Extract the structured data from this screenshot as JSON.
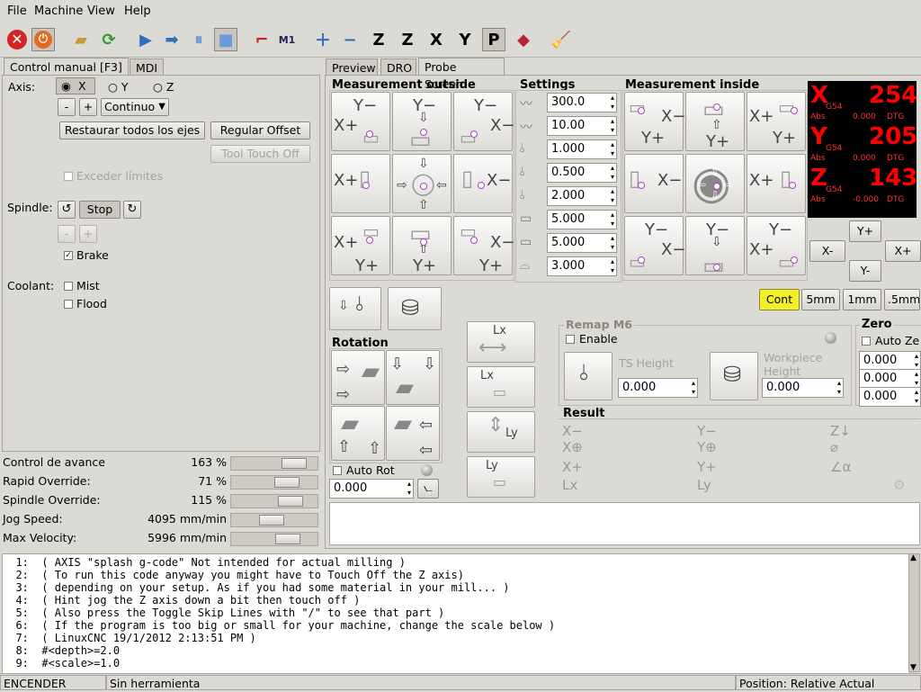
{
  "menu": {
    "file": "File",
    "machine": "Machine",
    "view": "View",
    "help": "Help"
  },
  "left_tabs": [
    "Control manual [F3]",
    "MDI"
  ],
  "manual": {
    "axis_label": "Axis:",
    "axes": [
      "X",
      "Y",
      "Z"
    ],
    "minus": "-",
    "plus": "+",
    "jog_mode": "Continuo",
    "restore_all": "Restaurar todos los ejes",
    "touch_off": "Regular Offset",
    "tool_touch_off": "Tool Touch Off",
    "override_limits": "Exceder límites",
    "spindle_label": "Spindle:",
    "stop": "Stop",
    "brake": "Brake",
    "coolant_label": "Coolant:",
    "mist": "Mist",
    "flood": "Flood"
  },
  "overrides": [
    {
      "label": "Control de avance",
      "value": "163 %",
      "level": 0.82
    },
    {
      "label": "Rapid Override:",
      "value": "71 %",
      "level": 0.71
    },
    {
      "label": "Spindle Override:",
      "value": "115 %",
      "level": 0.76
    },
    {
      "label": "Jog Speed:",
      "value": "4095 mm/min",
      "level": 0.45
    },
    {
      "label": "Max Velocity:",
      "value": "5996 mm/min",
      "level": 0.72
    }
  ],
  "right_tabs": [
    "Preview",
    "DRO",
    "Probe Screen"
  ],
  "probe": {
    "outside_title": "Measurement outside",
    "settings_title": "Settings",
    "inside_title": "Measurement inside",
    "settings": [
      "300.0",
      "10.00",
      "1.000",
      "0.500",
      "2.000",
      "5.000",
      "5.000",
      "3.000"
    ],
    "rotation_title": "Rotation",
    "auto_rot": "Auto Rot",
    "rot_value": "0.000",
    "remap_title": "Remap M6",
    "enable": "Enable",
    "ts_height": "TS Height",
    "ts_value": "0.000",
    "workpiece_height": "Workpiece\nHeight",
    "wp_value": "0.000",
    "result_title": "Result",
    "zero_title": "Zero",
    "auto_zero": "Auto Ze",
    "zero_values": [
      "0.000",
      "0.000",
      "0.000"
    ],
    "jog_steps": [
      "Cont",
      "5mm",
      "1mm",
      ".5mm"
    ],
    "jog_labels": {
      "yplus": "Y+",
      "xminus": "X-",
      "xplus": "X+",
      "yminus": "Y-"
    }
  },
  "dro": [
    {
      "axis": "X",
      "value": "254",
      "g": "G54",
      "abs": "Abs",
      "absval": "0.000",
      "dtg": "DTG"
    },
    {
      "axis": "Y",
      "value": "205",
      "g": "G54",
      "abs": "Abs",
      "absval": "0.000",
      "dtg": "DTG"
    },
    {
      "axis": "Z",
      "value": "143",
      "g": "G54",
      "abs": "Abs",
      "absval": "-0.000",
      "dtg": "DTG"
    }
  ],
  "gcode": [
    "  1:  ( AXIS \"splash g-code\" Not intended for actual milling )",
    "  2:  ( To run this code anyway you might have to Touch Off the Z axis)",
    "  3:  ( depending on your setup. As if you had some material in your mill... )",
    "  4:  ( Hint jog the Z axis down a bit then touch off )",
    "  5:  ( Also press the Toggle Skip Lines with \"/\" to see that part )",
    "  6:  ( If the program is too big or small for your machine, change the scale below )",
    "  7:  ( LinuxCNC 19/1/2012 2:13:51 PM )",
    "  8:  #<depth>=2.0",
    "  9:  #<scale>=1.0"
  ],
  "status": {
    "machine": "ENCENDER",
    "tool": "Sin herramienta",
    "position": "Position: Relative Actual"
  }
}
